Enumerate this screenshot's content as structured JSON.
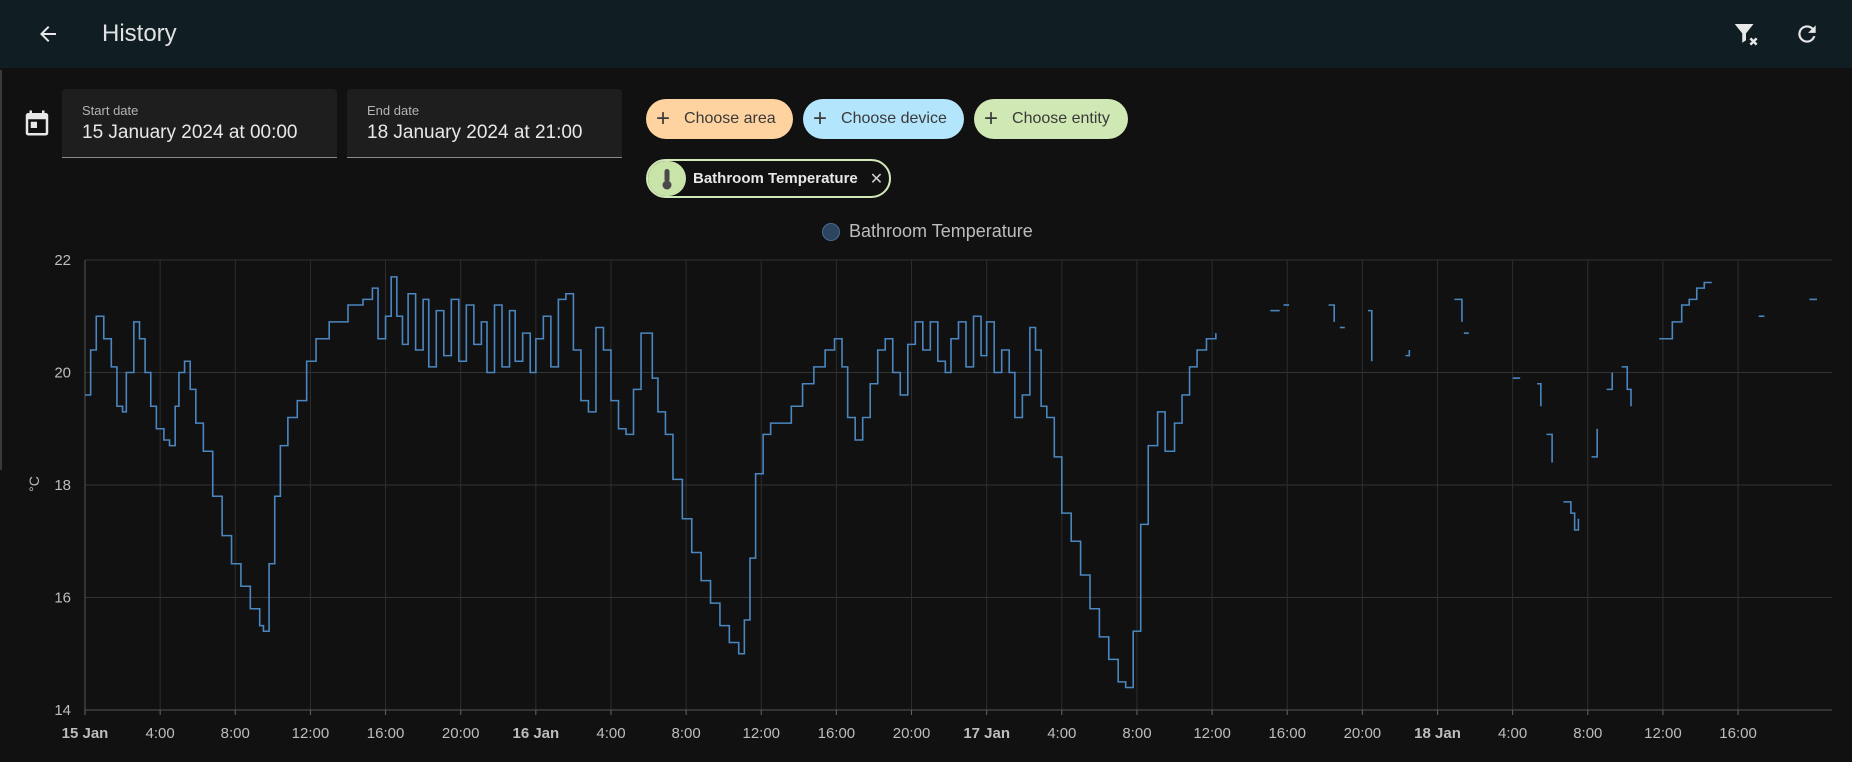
{
  "header": {
    "title": "History",
    "back_icon": "arrow-left-icon",
    "clear_filter_icon": "filter-remove-icon",
    "refresh_icon": "refresh-icon"
  },
  "filters": {
    "start_date": {
      "label": "Start date",
      "value": "15 January 2024 at 00:00"
    },
    "end_date": {
      "label": "End date",
      "value": "18 January 2024 at 21:00"
    },
    "chips": [
      {
        "label": "Choose area",
        "color": "#ffd3a0"
      },
      {
        "label": "Choose device",
        "color": "#b3e5fc"
      },
      {
        "label": "Choose entity",
        "color": "#cfe8b4"
      }
    ],
    "selected_entity": {
      "label": "Bathroom Temperature",
      "icon": "thermometer-icon"
    }
  },
  "chart_data": {
    "type": "line",
    "legend": "Bathroom Temperature",
    "ylabel": "°C",
    "ylim": [
      14,
      22
    ],
    "yticks": [
      14,
      16,
      18,
      20,
      22
    ],
    "x_range_hours": [
      0,
      93
    ],
    "xticks": [
      {
        "h": 0,
        "label": "15 Jan",
        "bold": true
      },
      {
        "h": 4,
        "label": "4:00"
      },
      {
        "h": 8,
        "label": "8:00"
      },
      {
        "h": 12,
        "label": "12:00"
      },
      {
        "h": 16,
        "label": "16:00"
      },
      {
        "h": 20,
        "label": "20:00"
      },
      {
        "h": 24,
        "label": "16 Jan",
        "bold": true
      },
      {
        "h": 28,
        "label": "4:00"
      },
      {
        "h": 32,
        "label": "8:00"
      },
      {
        "h": 36,
        "label": "12:00"
      },
      {
        "h": 40,
        "label": "16:00"
      },
      {
        "h": 44,
        "label": "20:00"
      },
      {
        "h": 48,
        "label": "17 Jan",
        "bold": true
      },
      {
        "h": 52,
        "label": "4:00"
      },
      {
        "h": 56,
        "label": "8:00"
      },
      {
        "h": 60,
        "label": "12:00"
      },
      {
        "h": 64,
        "label": "16:00"
      },
      {
        "h": 68,
        "label": "20:00"
      },
      {
        "h": 72,
        "label": "18 Jan",
        "bold": true
      },
      {
        "h": 76,
        "label": "4:00"
      },
      {
        "h": 80,
        "label": "8:00"
      },
      {
        "h": 84,
        "label": "12:00"
      },
      {
        "h": 88,
        "label": "16:00"
      }
    ],
    "series": [
      {
        "name": "Bathroom Temperature",
        "color": "#4a86c0",
        "points": [
          [
            0,
            19.6
          ],
          [
            0.3,
            20.4
          ],
          [
            0.6,
            21.0
          ],
          [
            1,
            20.6
          ],
          [
            1.4,
            20.1
          ],
          [
            1.7,
            19.4
          ],
          [
            2,
            19.3
          ],
          [
            2.2,
            20.0
          ],
          [
            2.6,
            20.9
          ],
          [
            2.9,
            20.6
          ],
          [
            3.2,
            20.0
          ],
          [
            3.5,
            19.4
          ],
          [
            3.8,
            19.0
          ],
          [
            4.2,
            18.8
          ],
          [
            4.5,
            18.7
          ],
          [
            4.8,
            19.4
          ],
          [
            5,
            20.0
          ],
          [
            5.3,
            20.2
          ],
          [
            5.6,
            19.7
          ],
          [
            5.9,
            19.1
          ],
          [
            6.3,
            18.6
          ],
          [
            6.8,
            17.8
          ],
          [
            7.3,
            17.1
          ],
          [
            7.8,
            16.6
          ],
          [
            8.3,
            16.2
          ],
          [
            8.8,
            15.8
          ],
          [
            9.3,
            15.5
          ],
          [
            9.5,
            15.4
          ],
          [
            9.8,
            16.6
          ],
          [
            10.1,
            17.8
          ],
          [
            10.4,
            18.7
          ],
          [
            10.8,
            19.2
          ],
          [
            11.3,
            19.5
          ],
          [
            11.8,
            20.2
          ],
          [
            12.3,
            20.6
          ],
          [
            13,
            20.9
          ],
          [
            14,
            21.2
          ],
          [
            14.8,
            21.3
          ],
          [
            15.3,
            21.5
          ],
          [
            15.6,
            20.6
          ],
          [
            16,
            21.0
          ],
          [
            16.3,
            21.7
          ],
          [
            16.6,
            21.0
          ],
          [
            16.9,
            20.5
          ],
          [
            17.2,
            21.4
          ],
          [
            17.6,
            20.4
          ],
          [
            18,
            21.3
          ],
          [
            18.3,
            20.1
          ],
          [
            18.7,
            21.1
          ],
          [
            19.1,
            20.3
          ],
          [
            19.5,
            21.3
          ],
          [
            19.9,
            20.2
          ],
          [
            20.3,
            21.2
          ],
          [
            20.7,
            20.5
          ],
          [
            21.1,
            20.9
          ],
          [
            21.4,
            20.0
          ],
          [
            21.8,
            21.2
          ],
          [
            22.2,
            20.1
          ],
          [
            22.6,
            21.1
          ],
          [
            22.9,
            20.2
          ],
          [
            23.3,
            20.7
          ],
          [
            23.7,
            20.0
          ],
          [
            24,
            20.6
          ],
          [
            24.4,
            21.0
          ],
          [
            24.8,
            20.1
          ],
          [
            25.2,
            21.3
          ],
          [
            25.6,
            21.4
          ],
          [
            26,
            20.4
          ],
          [
            26.4,
            19.5
          ],
          [
            26.8,
            19.3
          ],
          [
            27.2,
            20.8
          ],
          [
            27.6,
            20.4
          ],
          [
            28,
            19.5
          ],
          [
            28.4,
            19.0
          ],
          [
            28.8,
            18.9
          ],
          [
            29.2,
            19.7
          ],
          [
            29.6,
            20.7
          ],
          [
            30,
            20.7
          ],
          [
            30.2,
            19.9
          ],
          [
            30.5,
            19.3
          ],
          [
            30.9,
            18.9
          ],
          [
            31.3,
            18.1
          ],
          [
            31.8,
            17.4
          ],
          [
            32.3,
            16.8
          ],
          [
            32.8,
            16.3
          ],
          [
            33.3,
            15.9
          ],
          [
            33.8,
            15.5
          ],
          [
            34.3,
            15.2
          ],
          [
            34.8,
            15.0
          ],
          [
            35.1,
            15.6
          ],
          [
            35.4,
            16.7
          ],
          [
            35.7,
            18.2
          ],
          [
            36.1,
            18.9
          ],
          [
            36.5,
            19.1
          ],
          [
            37,
            19.1
          ],
          [
            37.6,
            19.4
          ],
          [
            38.2,
            19.8
          ],
          [
            38.8,
            20.1
          ],
          [
            39.4,
            20.4
          ],
          [
            39.9,
            20.6
          ],
          [
            40.3,
            20.1
          ],
          [
            40.6,
            19.2
          ],
          [
            41,
            18.8
          ],
          [
            41.4,
            19.2
          ],
          [
            41.8,
            19.8
          ],
          [
            42.2,
            20.4
          ],
          [
            42.6,
            20.6
          ],
          [
            43,
            20.0
          ],
          [
            43.4,
            19.6
          ],
          [
            43.8,
            20.5
          ],
          [
            44.2,
            20.9
          ],
          [
            44.6,
            20.4
          ],
          [
            45,
            20.9
          ],
          [
            45.4,
            20.2
          ],
          [
            45.8,
            20.0
          ],
          [
            46.1,
            20.6
          ],
          [
            46.5,
            20.9
          ],
          [
            46.9,
            20.1
          ],
          [
            47.3,
            21.0
          ],
          [
            47.7,
            20.3
          ],
          [
            48,
            20.9
          ],
          [
            48.4,
            20.0
          ],
          [
            48.8,
            20.4
          ],
          [
            49.2,
            20.0
          ],
          [
            49.5,
            19.2
          ],
          [
            49.9,
            19.6
          ],
          [
            50.3,
            20.8
          ],
          [
            50.6,
            20.4
          ],
          [
            50.9,
            19.4
          ],
          [
            51.2,
            19.2
          ],
          [
            51.6,
            18.5
          ],
          [
            52,
            17.5
          ],
          [
            52.5,
            17.0
          ],
          [
            53,
            16.4
          ],
          [
            53.5,
            15.8
          ],
          [
            54,
            15.3
          ],
          [
            54.5,
            14.9
          ],
          [
            55,
            14.5
          ],
          [
            55.4,
            14.4
          ],
          [
            55.8,
            15.4
          ],
          [
            56.2,
            17.3
          ],
          [
            56.6,
            18.7
          ],
          [
            57.1,
            19.3
          ],
          [
            57.5,
            18.6
          ],
          [
            58,
            19.1
          ],
          [
            58.4,
            19.6
          ],
          [
            58.8,
            20.1
          ],
          [
            59.2,
            20.4
          ],
          [
            59.7,
            20.6
          ],
          [
            60.2,
            20.7
          ]
        ],
        "segments": [
          [
            [
              63.1,
              21.1
            ],
            [
              63.6,
              21.1
            ]
          ],
          [
            [
              63.8,
              21.2
            ],
            [
              64.1,
              21.2
            ]
          ],
          [
            [
              66.2,
              21.2
            ],
            [
              66.5,
              20.9
            ]
          ],
          [
            [
              66.8,
              20.8
            ]
          ],
          [
            [
              68.3,
              21.1
            ],
            [
              68.5,
              20.2
            ]
          ],
          [
            [
              70.3,
              20.3
            ],
            [
              70.5,
              20.4
            ]
          ],
          [
            [
              72.9,
              21.3
            ],
            [
              73.3,
              20.9
            ]
          ],
          [
            [
              73.4,
              20.7
            ]
          ],
          [
            [
              76.0,
              19.9
            ],
            [
              76.4,
              19.9
            ]
          ],
          [
            [
              77.3,
              19.8
            ],
            [
              77.5,
              19.4
            ]
          ],
          [
            [
              77.8,
              18.9
            ],
            [
              78.1,
              18.4
            ]
          ],
          [
            [
              78.7,
              17.7
            ],
            [
              79.1,
              17.5
            ],
            [
              79.3,
              17.2
            ],
            [
              79.5,
              17.4
            ]
          ],
          [
            [
              80.2,
              18.5
            ],
            [
              80.5,
              19.0
            ]
          ],
          [
            [
              81,
              19.7
            ],
            [
              81.3,
              20.0
            ]
          ],
          [
            [
              81.8,
              20.1
            ],
            [
              82.1,
              19.7
            ],
            [
              82.3,
              19.4
            ]
          ],
          [
            [
              83.8,
              20.6
            ],
            [
              84.2,
              20.6
            ],
            [
              84.5,
              20.9
            ],
            [
              85,
              21.2
            ],
            [
              85.4,
              21.3
            ],
            [
              85.8,
              21.5
            ],
            [
              86.2,
              21.6
            ],
            [
              86.6,
              21.6
            ]
          ],
          [
            [
              89.1,
              21.0
            ],
            [
              89.4,
              21.0
            ]
          ],
          [
            [
              91.8,
              21.3
            ],
            [
              92.2,
              21.3
            ]
          ]
        ]
      }
    ]
  }
}
